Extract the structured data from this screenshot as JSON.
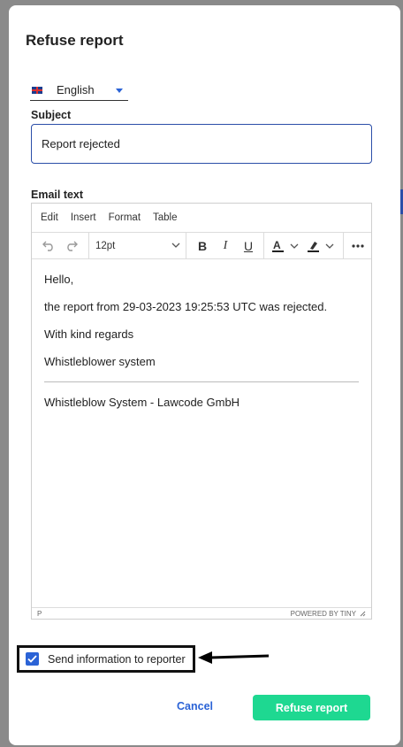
{
  "dialog": {
    "title": "Refuse report"
  },
  "language": {
    "selected": "English"
  },
  "subject": {
    "label": "Subject",
    "value": "Report rejected"
  },
  "email": {
    "label": "Email text",
    "menu": [
      "Edit",
      "Insert",
      "Format",
      "Table"
    ],
    "font_size": "12pt",
    "body": [
      "Hello,",
      "the report from 29-03-2023 19:25:53 UTC was rejected.",
      "With kind regards",
      "Whistleblower system"
    ],
    "signature": "Whistleblow System - Lawcode GmbH",
    "status_left": "P",
    "status_right": "POWERED BY TINY"
  },
  "checkbox": {
    "label": "Send information to reporter",
    "checked": true
  },
  "actions": {
    "cancel": "Cancel",
    "submit": "Refuse report"
  },
  "colors": {
    "primary": "#2b63d6",
    "submit_bg": "#1ed891"
  }
}
